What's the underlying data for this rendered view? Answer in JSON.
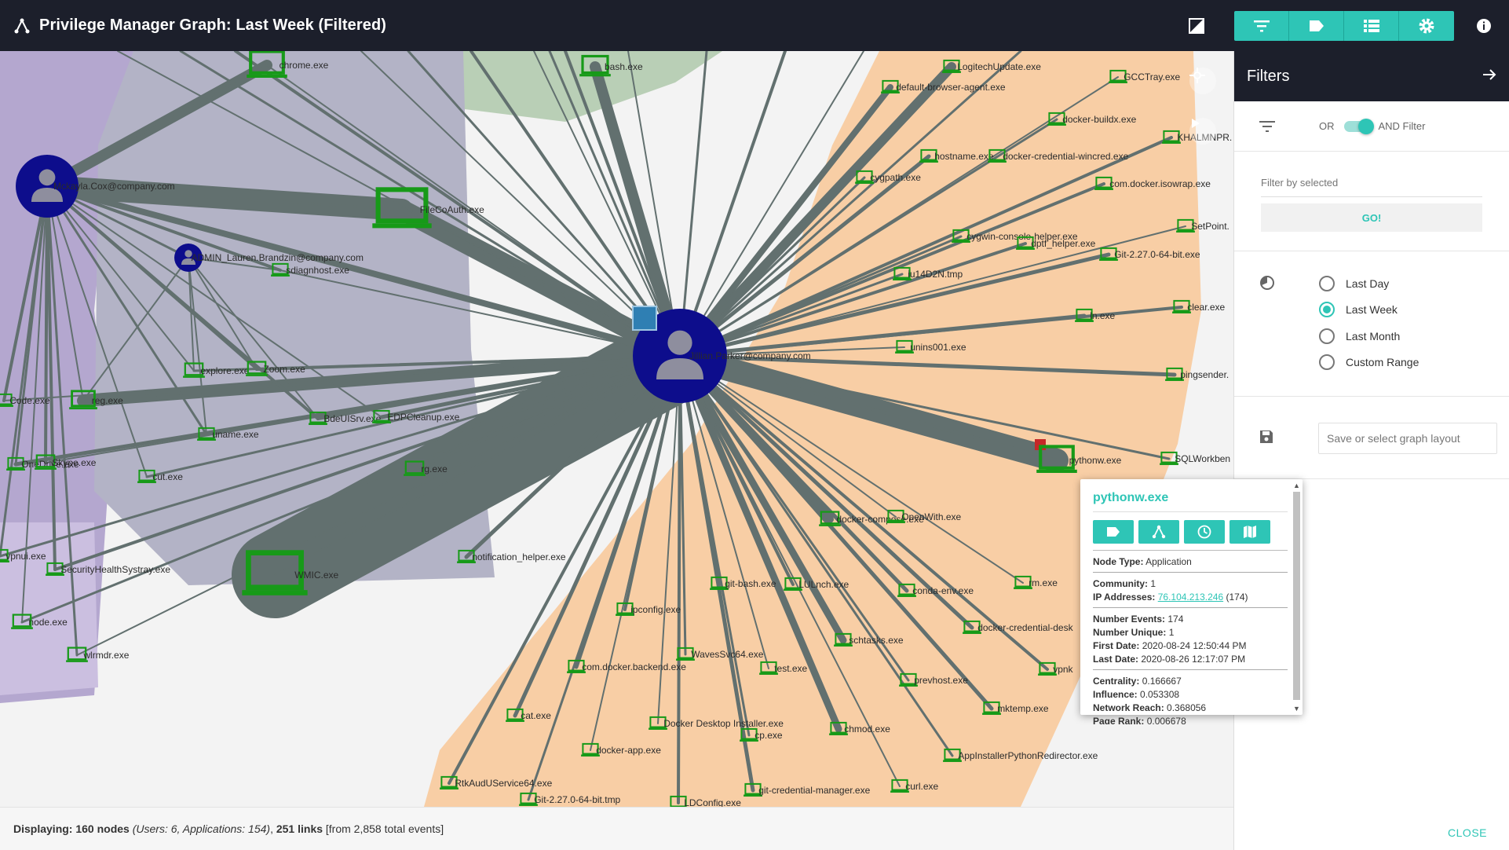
{
  "header": {
    "title": "Privilege Manager Graph: Last Week (Filtered)",
    "buttons": [
      "filter-icon",
      "tag-icon",
      "list-icon",
      "settings-icon"
    ]
  },
  "colors": {
    "accent": "#2ec5b6",
    "header_bg": "#1c1f2b",
    "user_node": "#0d0d8c",
    "app_node": "#179a18",
    "edge": "#62706f",
    "community_orange": "#f8cea5",
    "community_purple": "#b4a7cf",
    "community_slate": "#b3b3c6",
    "community_green": "#b9cfb6"
  },
  "graph": {
    "users": [
      {
        "label": "Mckayla.Cox@company.com"
      },
      {
        "label": "ADMIN_Lauren.Brandzin@company.com"
      },
      {
        "label": "Jillian.Parker@company.com"
      }
    ],
    "apps": [
      {
        "label": "chrome.exe"
      },
      {
        "label": "bash.exe"
      },
      {
        "label": "LogitechUpdate.exe"
      },
      {
        "label": "default-browser-agent.exe"
      },
      {
        "label": "GCCTray.exe"
      },
      {
        "label": "docker-buildx.exe"
      },
      {
        "label": "KHALMNPR."
      },
      {
        "label": "hostname.exe"
      },
      {
        "label": "docker-credential-wincred.exe"
      },
      {
        "label": "cygpath.exe"
      },
      {
        "label": "com.docker.isowrap.exe"
      },
      {
        "label": "FileCoAuth.exe"
      },
      {
        "label": "SetPoint."
      },
      {
        "label": "cygwin-console-helper.exe"
      },
      {
        "label": "dptf_helper.exe"
      },
      {
        "label": "Git-2.27.0-64-bit.exe"
      },
      {
        "label": "sdiagnhost.exe"
      },
      {
        "label": "iu14D2N.tmp"
      },
      {
        "label": "clear.exe"
      },
      {
        "label": "ln.exe"
      },
      {
        "label": "unins001.exe"
      },
      {
        "label": "explore.exe"
      },
      {
        "label": "Zoom.exe"
      },
      {
        "label": "pingsender."
      },
      {
        "label": "Code.exe"
      },
      {
        "label": "reg.exe"
      },
      {
        "label": "BdeUISrv.exe"
      },
      {
        "label": "EDPCleanup.exe"
      },
      {
        "label": "uname.exe"
      },
      {
        "label": "SQLWorkben"
      },
      {
        "label": "pythonw.exe"
      },
      {
        "label": "OneDrive.exe"
      },
      {
        "label": "Skype.exe"
      },
      {
        "label": "cut.exe"
      },
      {
        "label": "rg.exe"
      },
      {
        "label": "docker-compose.exe"
      },
      {
        "label": "OpenWith.exe"
      },
      {
        "label": "vpnui.exe"
      },
      {
        "label": "SecurityHealthSystray.exe"
      },
      {
        "label": "notification_helper.exe"
      },
      {
        "label": "WMIC.exe"
      },
      {
        "label": "git-bash.exe"
      },
      {
        "label": "LULnch.exe"
      },
      {
        "label": "conda-env.exe"
      },
      {
        "label": "rm.exe"
      },
      {
        "label": "node.exe"
      },
      {
        "label": "ipconfig.exe"
      },
      {
        "label": "docker-credential-desk"
      },
      {
        "label": "wlrmdr.exe"
      },
      {
        "label": "WavesSvc64.exe"
      },
      {
        "label": "schtasks.exe"
      },
      {
        "label": "com.docker.backend.exe"
      },
      {
        "label": "test.exe"
      },
      {
        "label": "prevhost.exe"
      },
      {
        "label": "vpnk"
      },
      {
        "label": "cat.exe"
      },
      {
        "label": "Docker Desktop Installer.exe"
      },
      {
        "label": "cp.exe"
      },
      {
        "label": "chmod.exe"
      },
      {
        "label": "mktemp.exe"
      },
      {
        "label": "docker-app.exe"
      },
      {
        "label": "AppInstallerPythonRedirector.exe"
      },
      {
        "label": "RtkAudUService64.exe"
      },
      {
        "label": "git-credential-manager.exe"
      },
      {
        "label": "curl.exe"
      },
      {
        "label": "Git-2.27.0-64-bit.tmp"
      },
      {
        "label": "LDConfig.exe"
      }
    ]
  },
  "status": {
    "prefix": "Displaying:",
    "nodes": "160 nodes",
    "breakdown": "(Users: 6, Applications: 154)",
    "links": "251 links",
    "total": "[from 2,858 total events]"
  },
  "filters": {
    "title": "Filters",
    "toggle_or": "OR",
    "toggle_and": "AND Filter",
    "filter_placeholder": "Filter by selected",
    "go_label": "GO!",
    "time_options": [
      "Last Day",
      "Last Week",
      "Last Month",
      "Custom Range"
    ],
    "selected_time": "Last Week",
    "layout_placeholder": "Save or select graph layout",
    "close_label": "CLOSE"
  },
  "popup": {
    "title": "pythonw.exe",
    "node_type_key": "Node Type:",
    "node_type": "Application",
    "community_key": "Community:",
    "community": "1",
    "ip_key": "IP Addresses:",
    "ip": "76.104.213.246",
    "ip_count": "(174)",
    "events_key": "Number Events:",
    "events": "174",
    "unique_key": "Number Unique:",
    "unique": "1",
    "first_key": "First Date:",
    "first": "2020-08-24 12:50:44 PM",
    "last_key": "Last Date:",
    "last": "2020-08-26 12:17:07 PM",
    "centrality_key": "Centrality:",
    "centrality": "0.166667",
    "influence_key": "Influence:",
    "influence": "0.053308",
    "reach_key": "Network Reach:",
    "reach": "0.368056",
    "rank_key": "Page Rank:",
    "rank": "0.006678"
  }
}
